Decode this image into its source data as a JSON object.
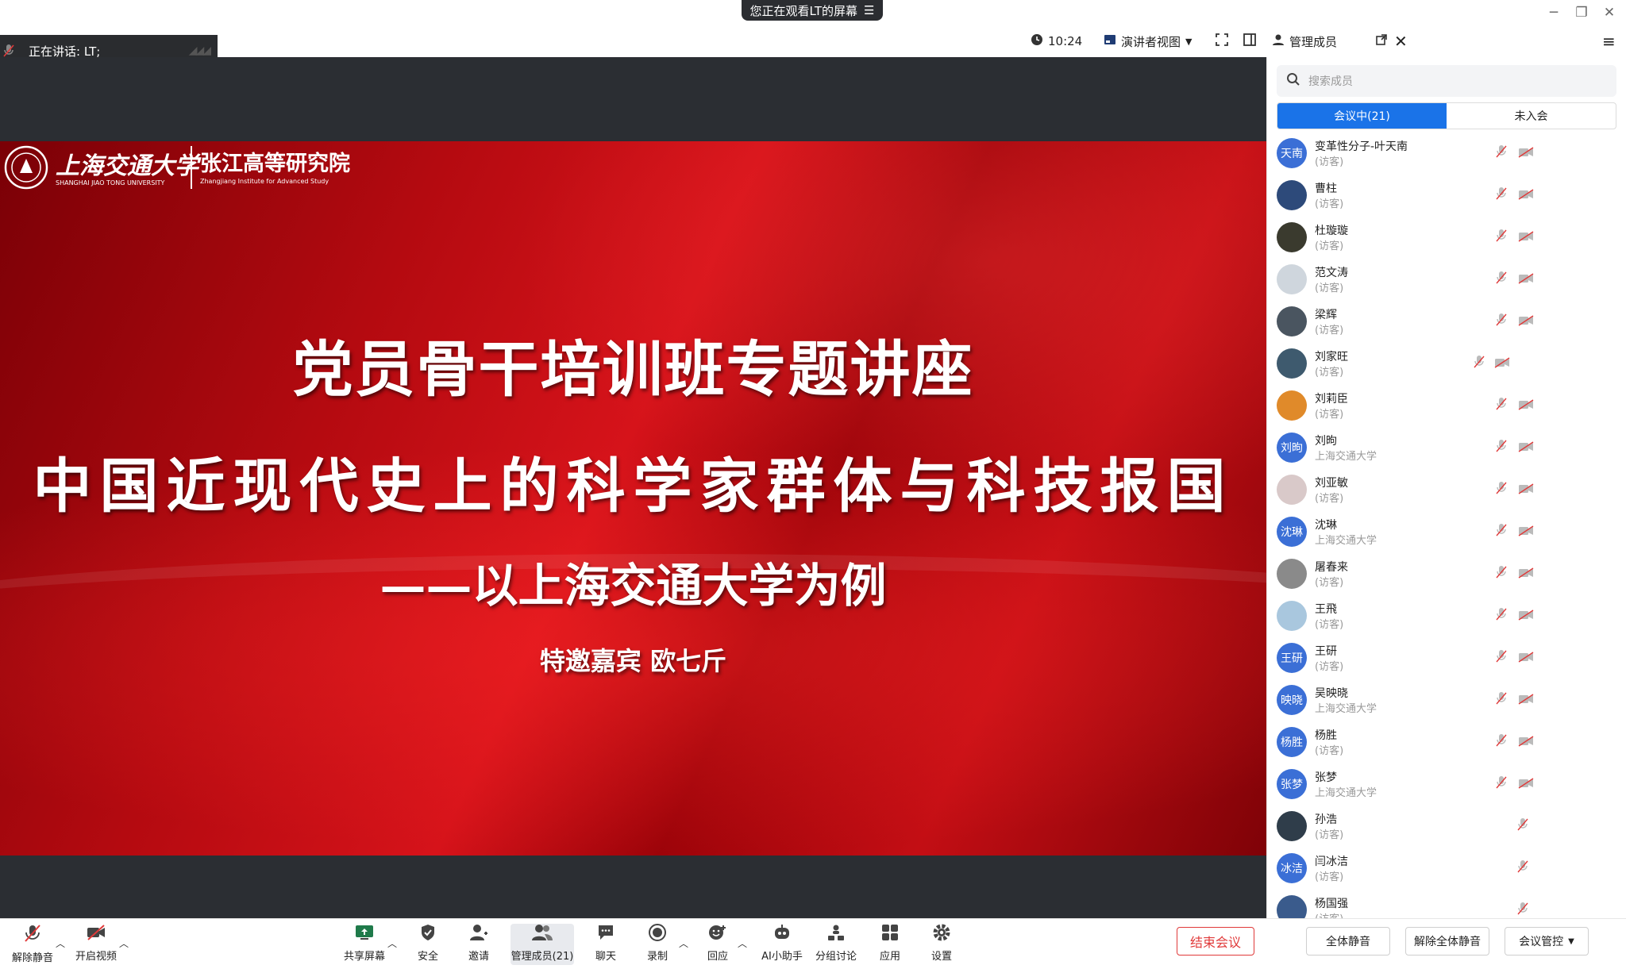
{
  "banner": {
    "text": "您正在观看LT的屏幕"
  },
  "speaking": {
    "label": "正在讲话:  LT;"
  },
  "toolbar": {
    "time": "10:24",
    "view_mode": "演讲者视图",
    "manage_members": "管理成员"
  },
  "slide": {
    "school_cn": "上海交通大学",
    "school_en": "SHANGHAI JIAO TONG UNIVERSITY",
    "institute_cn": "张江高等研究院",
    "institute_en": "Zhangjiang Institute for Advanced Study",
    "title": "党员骨干培训班专题讲座",
    "subtitle": "中国近现代史上的科学家群体与科技报国",
    "subtitle2": "——以上海交通大学为例",
    "guest": "特邀嘉宾  欧七斤"
  },
  "panel": {
    "search_placeholder": "搜索成员",
    "tab_in_meeting": "会议中(21)",
    "tab_not_joined": "未入会",
    "members": [
      {
        "name": "变革性分子-叶天南",
        "sub": "(访客)",
        "avatar_text": "天南",
        "avatar_color": "#3b6fd6"
      },
      {
        "name": "曹柱",
        "sub": "(访客)",
        "avatar_text": "",
        "avatar_color": "#2d4a7a"
      },
      {
        "name": "杜璇璇",
        "sub": "(访客)",
        "avatar_text": "",
        "avatar_color": "#3a3a2e"
      },
      {
        "name": "范文涛",
        "sub": "(访客)",
        "avatar_text": "",
        "avatar_color": "#cfd6dd"
      },
      {
        "name": "梁辉",
        "sub": "(访客)",
        "avatar_text": "",
        "avatar_color": "#4a5560"
      },
      {
        "name": "刘家旺",
        "sub": "(访客)",
        "avatar_text": "",
        "avatar_color": "#3e5a6e"
      },
      {
        "name": "刘莉臣",
        "sub": "(访客)",
        "avatar_text": "",
        "avatar_color": "#e08a2a"
      },
      {
        "name": "刘昫",
        "sub": "上海交通大学",
        "avatar_text": "刘昫",
        "avatar_color": "#3b6fd6"
      },
      {
        "name": "刘亚敏",
        "sub": "(访客)",
        "avatar_text": "",
        "avatar_color": "#d9c9c9"
      },
      {
        "name": "沈琳",
        "sub": "上海交通大学",
        "avatar_text": "沈琳",
        "avatar_color": "#3b6fd6"
      },
      {
        "name": "屠春来",
        "sub": "(访客)",
        "avatar_text": "",
        "avatar_color": "#8a8a8a"
      },
      {
        "name": "王飛",
        "sub": "(访客)",
        "avatar_text": "",
        "avatar_color": "#a9c7de"
      },
      {
        "name": "王研",
        "sub": "(访客)",
        "avatar_text": "王研",
        "avatar_color": "#3b6fd6"
      },
      {
        "name": "吴映晓",
        "sub": "上海交通大学",
        "avatar_text": "映晓",
        "avatar_color": "#3b6fd6"
      },
      {
        "name": "杨胜",
        "sub": "(访客)",
        "avatar_text": "杨胜",
        "avatar_color": "#3b6fd6"
      },
      {
        "name": "张梦",
        "sub": "上海交通大学",
        "avatar_text": "张梦",
        "avatar_color": "#3b6fd6"
      },
      {
        "name": "孙浩",
        "sub": "(访客)",
        "avatar_text": "",
        "avatar_color": "#2f3d4a"
      },
      {
        "name": "闫冰洁",
        "sub": "(访客)",
        "avatar_text": "冰洁",
        "avatar_color": "#3b6fd6"
      },
      {
        "name": "杨国强",
        "sub": "(访客)",
        "avatar_text": "",
        "avatar_color": "#3a5b8c"
      }
    ]
  },
  "bottombar": {
    "unmute": "解除静音",
    "start_video": "开启视频",
    "share_screen": "共享屏幕",
    "security": "安全",
    "invite": "邀请",
    "manage_members": "管理成员(21)",
    "chat": "聊天",
    "record": "录制",
    "reactions": "回应",
    "ai_assistant": "AI小助手",
    "breakout": "分组讨论",
    "apps": "应用",
    "settings": "设置",
    "end_meeting": "结束会议",
    "mute_all": "全体静音",
    "unmute_all": "解除全体静音",
    "meeting_control": "会议管控"
  },
  "colors": {
    "accent": "#1a73e8",
    "danger": "#e03a3a",
    "slide_red": "#c30e14"
  }
}
